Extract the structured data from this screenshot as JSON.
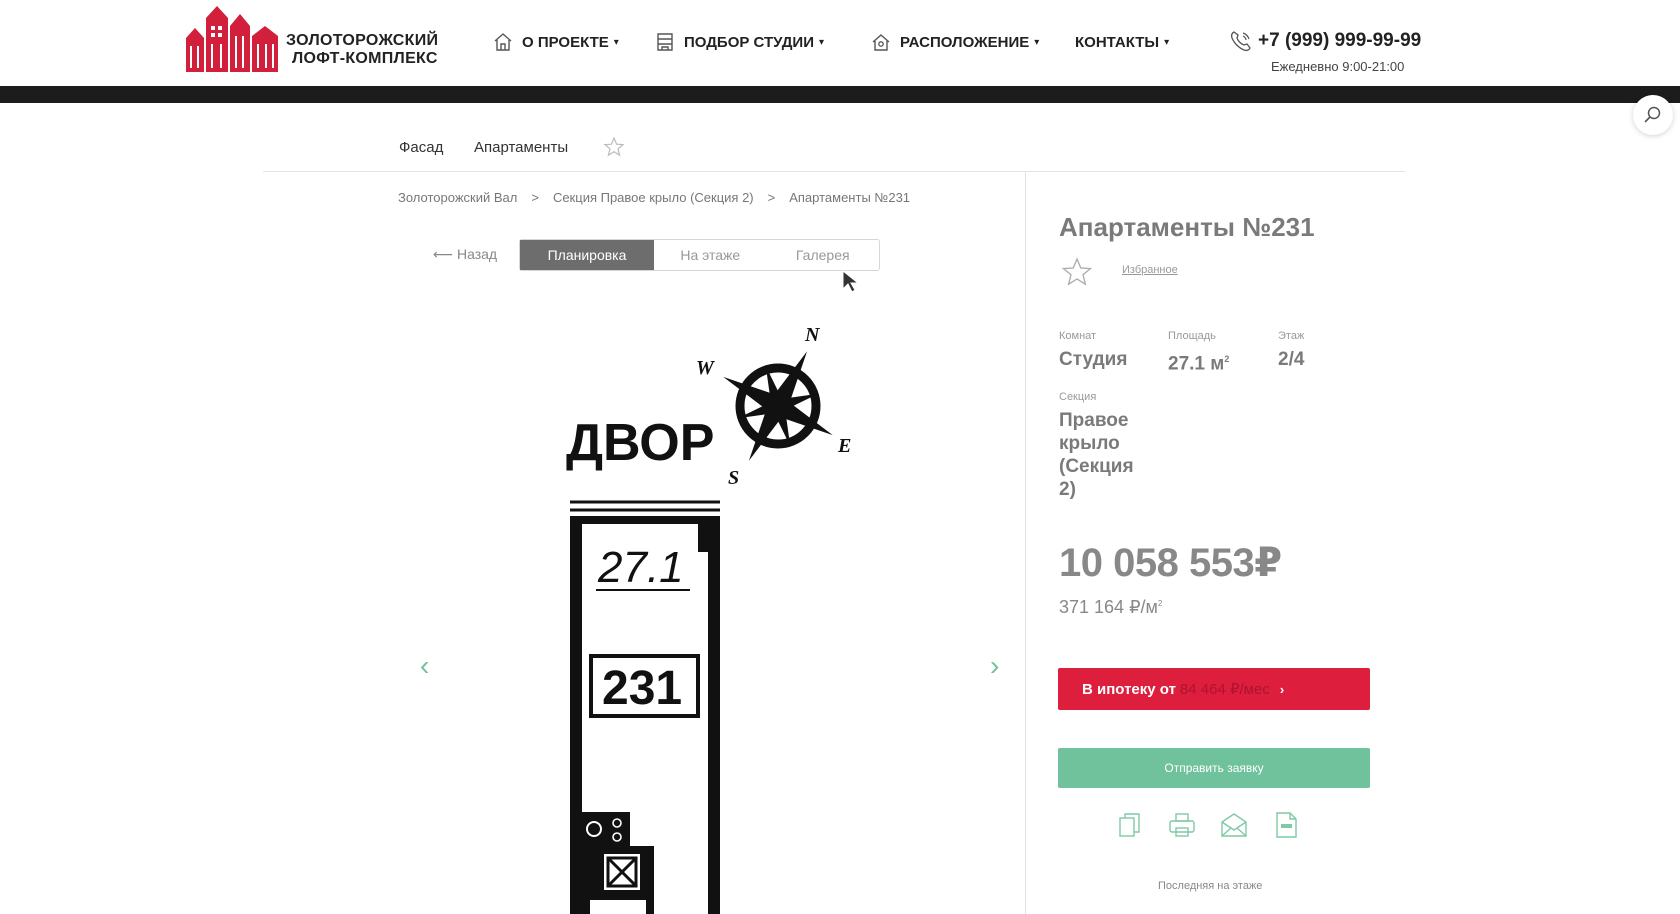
{
  "header": {
    "logo": {
      "line1": "ЗОЛОТОРОЖСКИЙ",
      "line2": "ЛОФТ-КОМПЛЕКС",
      "brand_color": "#d11f3c"
    },
    "nav": [
      {
        "label": "О ПРОЕКТЕ",
        "icon": "house-icon"
      },
      {
        "label": "ПОДБОР СТУДИИ",
        "icon": "building-icon"
      },
      {
        "label": "РАСПОЛОЖЕНИЕ",
        "icon": "location-icon"
      },
      {
        "label": "КОНТАКТЫ",
        "icon": ""
      }
    ],
    "caret": "▾",
    "phone": "+7 (999) 999-99-99",
    "hours": "Ежедневно 9:00-21:00"
  },
  "subnav": {
    "items": [
      "Фасад",
      "Апартаменты"
    ]
  },
  "breadcrumb": [
    "Золоторожский Вал",
    ">",
    "Секция Правое крыло (Секция 2)",
    ">",
    "Апартаменты №231"
  ],
  "view": {
    "back_label": "⟵ Назад",
    "tabs": [
      "Планировка",
      "На этаже",
      "Галерея"
    ],
    "active_tab": "Планировка"
  },
  "plan": {
    "courtyard_label": "ДВОР",
    "area_label": "27.1",
    "unit_label": "231",
    "compass": {
      "n": "N",
      "s": "S",
      "e": "E",
      "w": "W"
    },
    "prev_arrow": "‹",
    "next_arrow": "›"
  },
  "apartment": {
    "title": "Апартаменты №231",
    "favorite_label": "Избранное",
    "props": {
      "rooms": {
        "label": "Комнат",
        "value": "Студия"
      },
      "area": {
        "label": "Площадь",
        "value": "27.1 м",
        "sup": "2"
      },
      "floor": {
        "label": "Этаж",
        "value": "2/4"
      },
      "section": {
        "label": "Секция",
        "lines": [
          "Правое",
          "крыло",
          "(Секция",
          "2)"
        ]
      }
    },
    "price": "10 058 553₽",
    "price_per_m2": "371 164 ₽/м",
    "price_per_m2_sup": "2"
  },
  "actions": {
    "mortgage_label": "В ипотеку от",
    "mortgage_amount": "84 464 ₽/мес",
    "mortgage_chevron": "›",
    "request_label": "Отправить заявку",
    "icons": [
      "copy-icon",
      "print-icon",
      "mail-icon",
      "pdf-icon"
    ],
    "last_on_floor": "Последняя на этаже"
  },
  "colors": {
    "accent_red": "#dd1f3d",
    "accent_green": "#6fc29c",
    "dark_bar": "#1c1c1c"
  }
}
